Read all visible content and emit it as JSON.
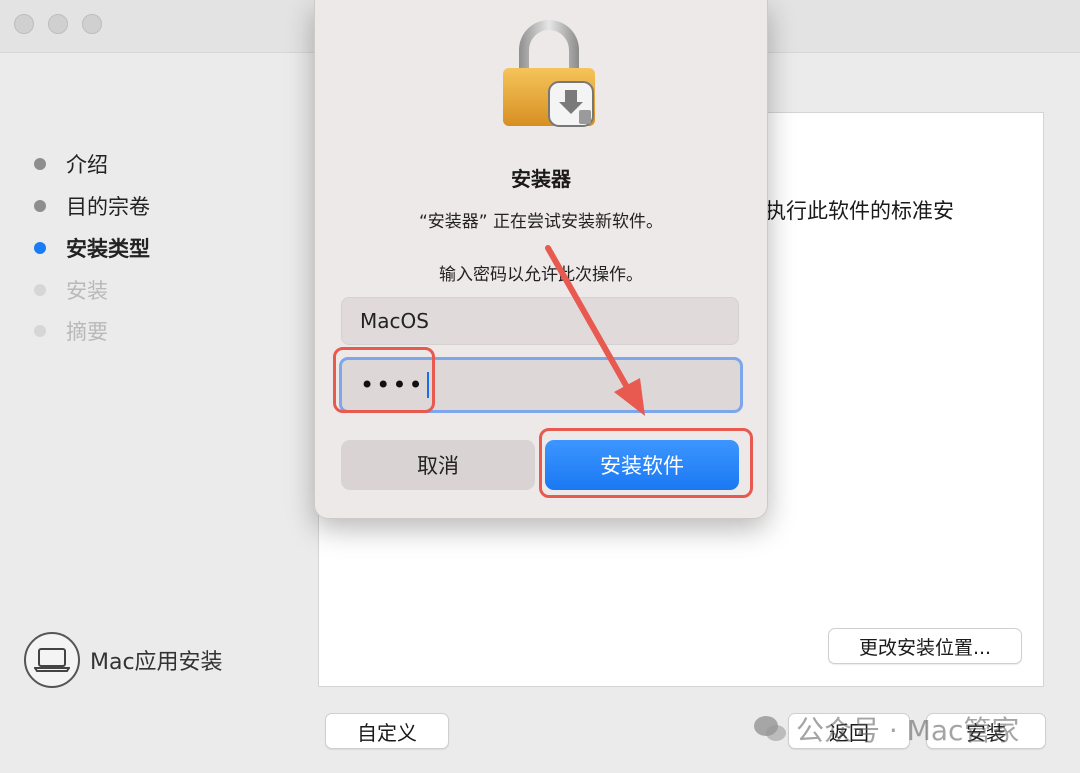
{
  "window": {
    "traffic_lights": [
      "close",
      "minimize",
      "zoom"
    ]
  },
  "sidebar": {
    "steps": [
      {
        "label": "介绍",
        "state": "done"
      },
      {
        "label": "目的宗卷",
        "state": "done"
      },
      {
        "label": "安装类型",
        "state": "current"
      },
      {
        "label": "安装",
        "state": "pending"
      },
      {
        "label": "摘要",
        "state": "pending"
      }
    ],
    "brand_label": "Mac应用安装"
  },
  "content": {
    "description_fragment": "执行此软件的标准安",
    "change_location_label": "更改安装位置..."
  },
  "bottom_bar": {
    "customize_label": "自定义",
    "back_label": "返回",
    "install_label": "安装"
  },
  "dialog": {
    "title": "安装器",
    "message": "“安装器” 正在尝试安装新软件。",
    "prompt": "输入密码以允许此次操作。",
    "username_value": "MacOS",
    "password_masked": "••••",
    "cancel_label": "取消",
    "install_software_label": "安装软件"
  },
  "watermark": {
    "text": "公众号 · Mac管家"
  },
  "colors": {
    "accent_blue": "#1a7cf5",
    "annotation_red": "#e85a50",
    "lock_gold": "#e8a93a"
  }
}
